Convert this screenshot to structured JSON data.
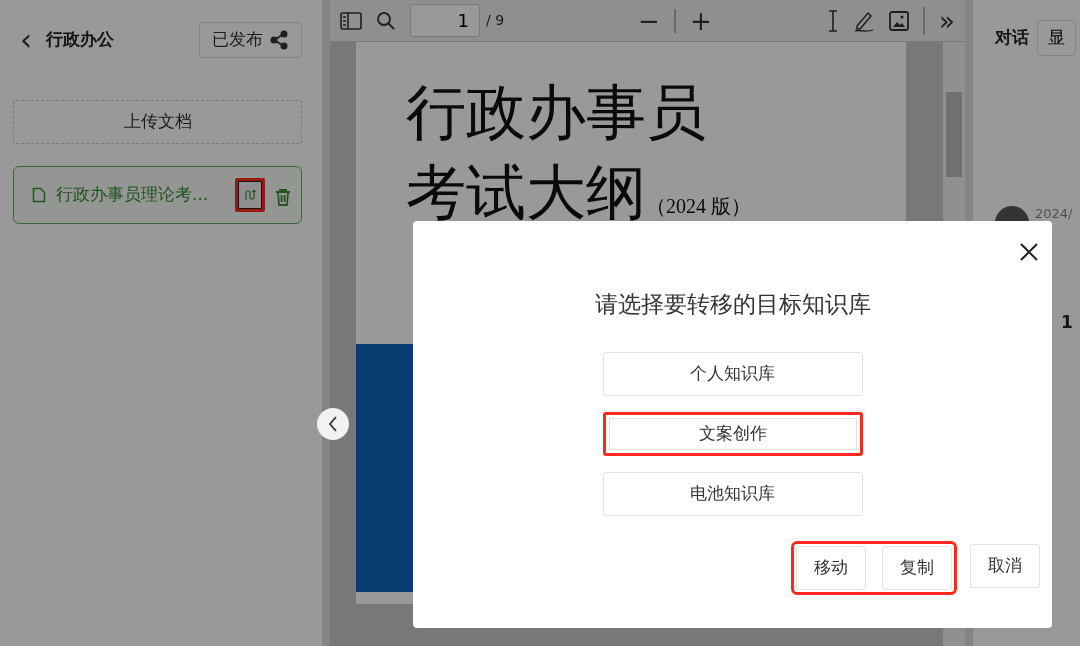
{
  "sidebar": {
    "back": "‹",
    "title": "行政办公",
    "publish_button": "已发布",
    "upload_button": "上传文档",
    "files": [
      {
        "name": "行政办事员理论考...",
        "selected": true,
        "transfer_annotated": true
      }
    ]
  },
  "viewer": {
    "page_input": "1",
    "page_total": "/ 9",
    "zoom_out": "−",
    "zoom_in": "+",
    "expand": "»",
    "page": {
      "title_line_1": "行政办事员",
      "title_line_2": "考试大纲",
      "edition": "（2024 版）"
    }
  },
  "chat_panel": {
    "title": "对话",
    "button": "显",
    "date": "2024/",
    "number": "1"
  },
  "dialog": {
    "title": "请选择要转移的目标知识库",
    "options": [
      {
        "label": "个人知识库",
        "annotated": false
      },
      {
        "label": "文案创作",
        "annotated": true
      },
      {
        "label": "电池知识库",
        "annotated": false
      }
    ],
    "actions": [
      {
        "label": "移动",
        "kind": "primary"
      },
      {
        "label": "复制",
        "kind": "primary"
      },
      {
        "label": "取消",
        "kind": "cancel"
      }
    ],
    "actions_annotated": true
  }
}
